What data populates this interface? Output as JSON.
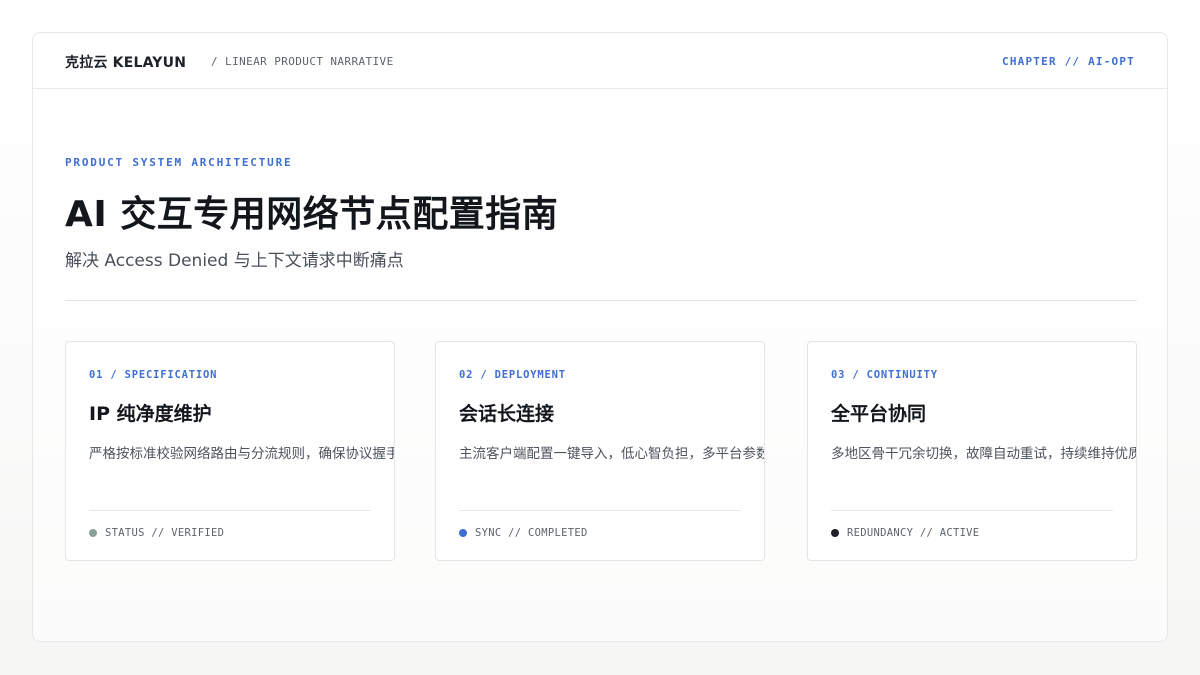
{
  "header": {
    "brand": "克拉云 KELAYUN",
    "narrative": "/ LINEAR PRODUCT NARRATIVE",
    "chapter": "CHAPTER // AI-OPT"
  },
  "hero": {
    "eyebrow": "PRODUCT SYSTEM ARCHITECTURE",
    "title": "AI 交互专用网络节点配置指南",
    "subtitle": "解决 Access Denied 与上下文请求中断痛点"
  },
  "cards": [
    {
      "tag": "01 / SPECIFICATION",
      "title": "IP 纯净度维护",
      "description": "严格按标准校验网络路由与分流规则，确保协议握手稳定",
      "status": "STATUS // VERIFIED",
      "status_color": "#8aa194"
    },
    {
      "tag": "02 / DEPLOYMENT",
      "title": "会话长连接",
      "description": "主流客户端配置一键导入，低心智负担，多平台参数保持一致",
      "status": "SYNC // COMPLETED",
      "status_color": "#3f6fd1"
    },
    {
      "tag": "03 / CONTINUITY",
      "title": "全平台协同",
      "description": "多地区骨干冗余切换，故障自动重试，持续维持优质连接体验",
      "status": "REDUNDANCY // ACTIVE",
      "status_color": "#1d2229"
    }
  ],
  "colors": {
    "accent": "#3f6fd1",
    "text": "#13171c",
    "muted": "#5d636c",
    "border": "#e3e5e9"
  }
}
